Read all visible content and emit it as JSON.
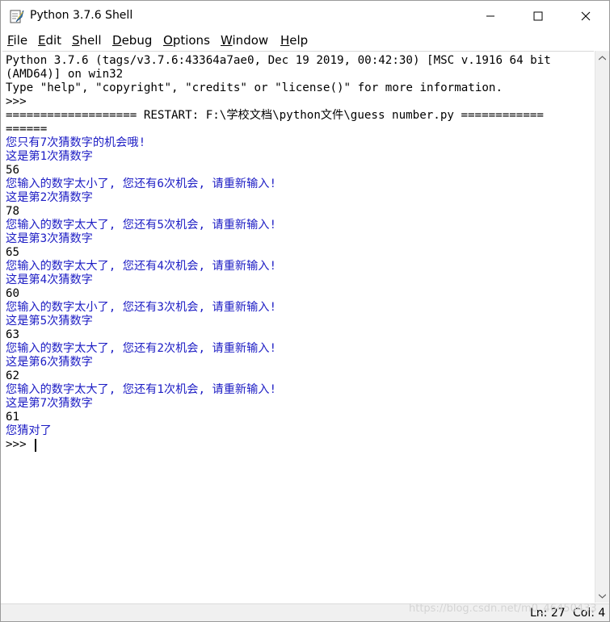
{
  "window": {
    "title": "Python 3.7.6 Shell",
    "icon": "python-feather-icon"
  },
  "menu": [
    "File",
    "Edit",
    "Shell",
    "Debug",
    "Options",
    "Window",
    "Help"
  ],
  "shell_lines": [
    {
      "text": "Python 3.7.6 (tags/v3.7.6:43364a7ae0, Dec 19 2019, 00:42:30) [MSC v.1916 64 bit",
      "color": "black"
    },
    {
      "text": "(AMD64)] on win32",
      "color": "black"
    },
    {
      "text": "Type \"help\", \"copyright\", \"credits\" or \"license()\" for more information.",
      "color": "black"
    },
    {
      "text": ">>> ",
      "color": "black"
    },
    {
      "text": "=================== RESTART: F:\\学校文档\\python文件\\guess number.py ============",
      "color": "black"
    },
    {
      "text": "======",
      "color": "black"
    },
    {
      "text": "您只有7次猜数字的机会哦!",
      "color": "blue"
    },
    {
      "text": "这是第1次猜数字",
      "color": "blue"
    },
    {
      "text": "56",
      "color": "black"
    },
    {
      "text": "您输入的数字太小了, 您还有6次机会, 请重新输入!",
      "color": "blue"
    },
    {
      "text": "这是第2次猜数字",
      "color": "blue"
    },
    {
      "text": "78",
      "color": "black"
    },
    {
      "text": "您输入的数字太大了, 您还有5次机会, 请重新输入!",
      "color": "blue"
    },
    {
      "text": "这是第3次猜数字",
      "color": "blue"
    },
    {
      "text": "65",
      "color": "black"
    },
    {
      "text": "您输入的数字太大了, 您还有4次机会, 请重新输入!",
      "color": "blue"
    },
    {
      "text": "这是第4次猜数字",
      "color": "blue"
    },
    {
      "text": "60",
      "color": "black"
    },
    {
      "text": "您输入的数字太小了, 您还有3次机会, 请重新输入!",
      "color": "blue"
    },
    {
      "text": "这是第5次猜数字",
      "color": "blue"
    },
    {
      "text": "63",
      "color": "black"
    },
    {
      "text": "您输入的数字太大了, 您还有2次机会, 请重新输入!",
      "color": "blue"
    },
    {
      "text": "这是第6次猜数字",
      "color": "blue"
    },
    {
      "text": "62",
      "color": "black"
    },
    {
      "text": "您输入的数字太大了, 您还有1次机会, 请重新输入!",
      "color": "blue"
    },
    {
      "text": "这是第7次猜数字",
      "color": "blue"
    },
    {
      "text": "61",
      "color": "black"
    },
    {
      "text": "您猜对了",
      "color": "blue"
    },
    {
      "text": ">>> ",
      "color": "black"
    }
  ],
  "status": {
    "line": "Ln: 27",
    "col": "Col: 4"
  },
  "watermark": "https://blog.csdn.net/m0_46450433",
  "colors": {
    "output_blue": "#1c1cc4",
    "text_black": "#000000"
  }
}
